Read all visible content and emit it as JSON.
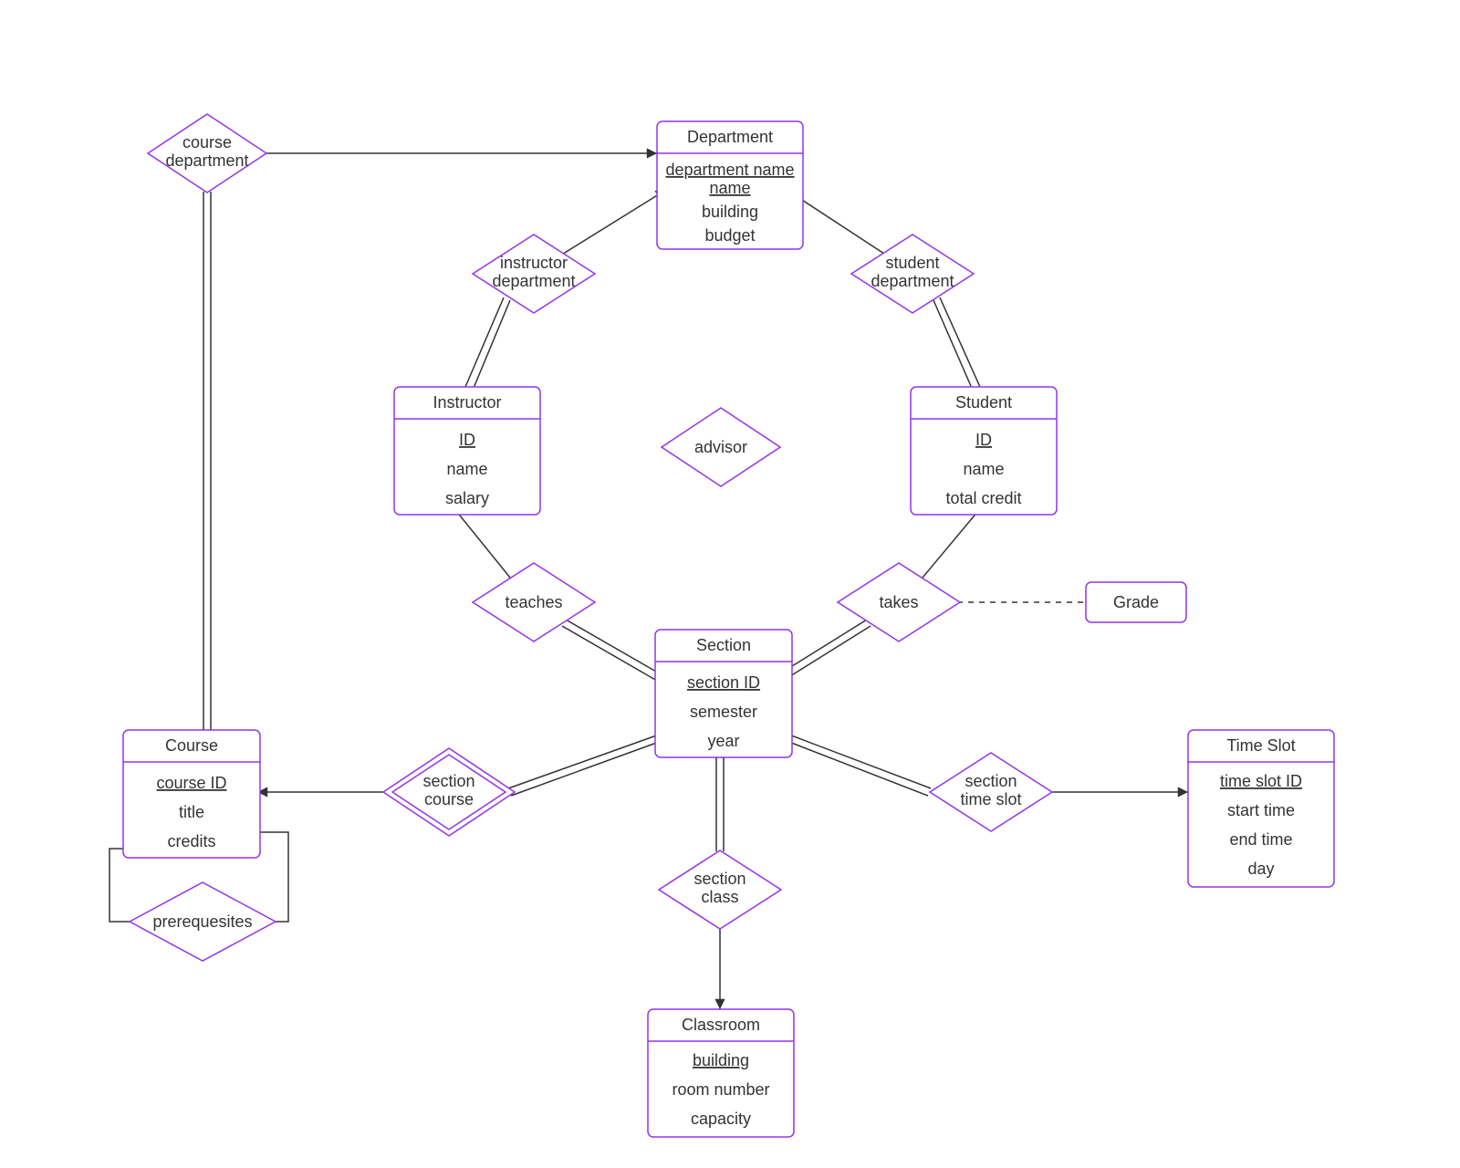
{
  "entities": {
    "department": {
      "title": "Department",
      "pk": "department name",
      "a1": "building",
      "a2": "budget"
    },
    "instructor": {
      "title": "Instructor",
      "pk": "ID",
      "a1": "name",
      "a2": "salary"
    },
    "student": {
      "title": "Student",
      "pk": "ID",
      "a1": "name",
      "a2": "total credit"
    },
    "section": {
      "title": "Section",
      "pk": "section ID",
      "a1": "semester",
      "a2": "year"
    },
    "course": {
      "title": "Course",
      "pk": "course ID",
      "a1": "title",
      "a2": "credits"
    },
    "timeslot": {
      "title": "Time Slot",
      "pk": "time slot ID",
      "a1": "start time",
      "a2": "end time",
      "a3": "day"
    },
    "classroom": {
      "title": "Classroom",
      "pk": "building",
      "a1": "room number",
      "a2": "capacity"
    },
    "grade": {
      "title": "Grade"
    }
  },
  "relationships": {
    "courseDept": {
      "l1": "course",
      "l2": "department"
    },
    "instructorDept": {
      "l1": "instructor",
      "l2": "department"
    },
    "studentDept": {
      "l1": "student",
      "l2": "department"
    },
    "advisor": {
      "l1": "advisor"
    },
    "teaches": {
      "l1": "teaches"
    },
    "takes": {
      "l1": "takes"
    },
    "sectionCourse": {
      "l1": "section",
      "l2": "course"
    },
    "sectionTime": {
      "l1": "section",
      "l2": "time slot"
    },
    "sectionClass": {
      "l1": "section",
      "l2": "class"
    },
    "prereq": {
      "l1": "prerequesites"
    }
  }
}
